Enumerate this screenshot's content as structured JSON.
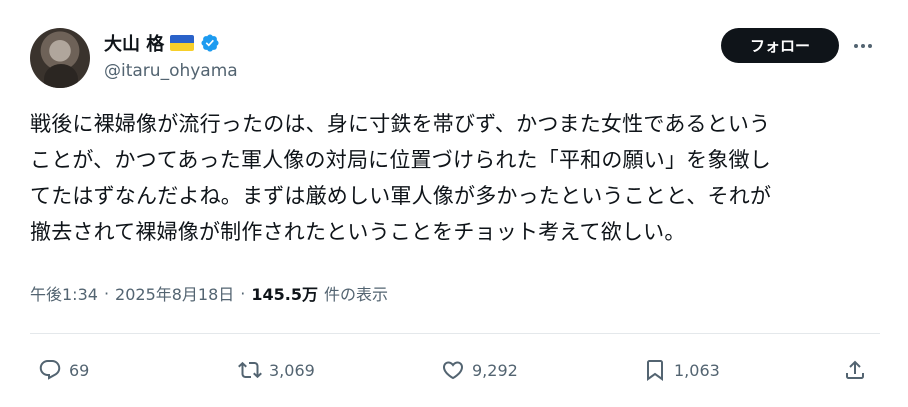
{
  "author": {
    "name": "大山 格",
    "handle": "@itaru_ohyama",
    "avatar_icon": "avatar",
    "flag_icon": "ukraine-flag-icon",
    "verified_icon": "verified-badge-icon"
  },
  "header": {
    "follow_label": "フォロー",
    "more_icon": "more-icon"
  },
  "tweet": {
    "lines": [
      "戦後に裸婦像が流行ったのは、身に寸鉄を帯びず、かつまた女性であるという",
      "ことが、かつてあった軍人像の対局に位置づけられた「平和の願い」を象徴し",
      "てたはずなんだよね。まずは厳めしい軍人像が多かったということと、それが",
      "撤去されて裸婦像が制作されたということをチョット考えて欲しい。"
    ]
  },
  "meta": {
    "time": "午後1:34",
    "separator": "·",
    "date": "2025年8月18日",
    "views_count": "145.5万",
    "views_label": "件の表示"
  },
  "actions": {
    "replies": "69",
    "retweets": "3,069",
    "likes": "9,292",
    "bookmarks": "1,063"
  },
  "colors": {
    "text": "#0f1419",
    "secondary": "#536471",
    "verified": "#1d9bf0",
    "button_bg": "#0f1419"
  }
}
